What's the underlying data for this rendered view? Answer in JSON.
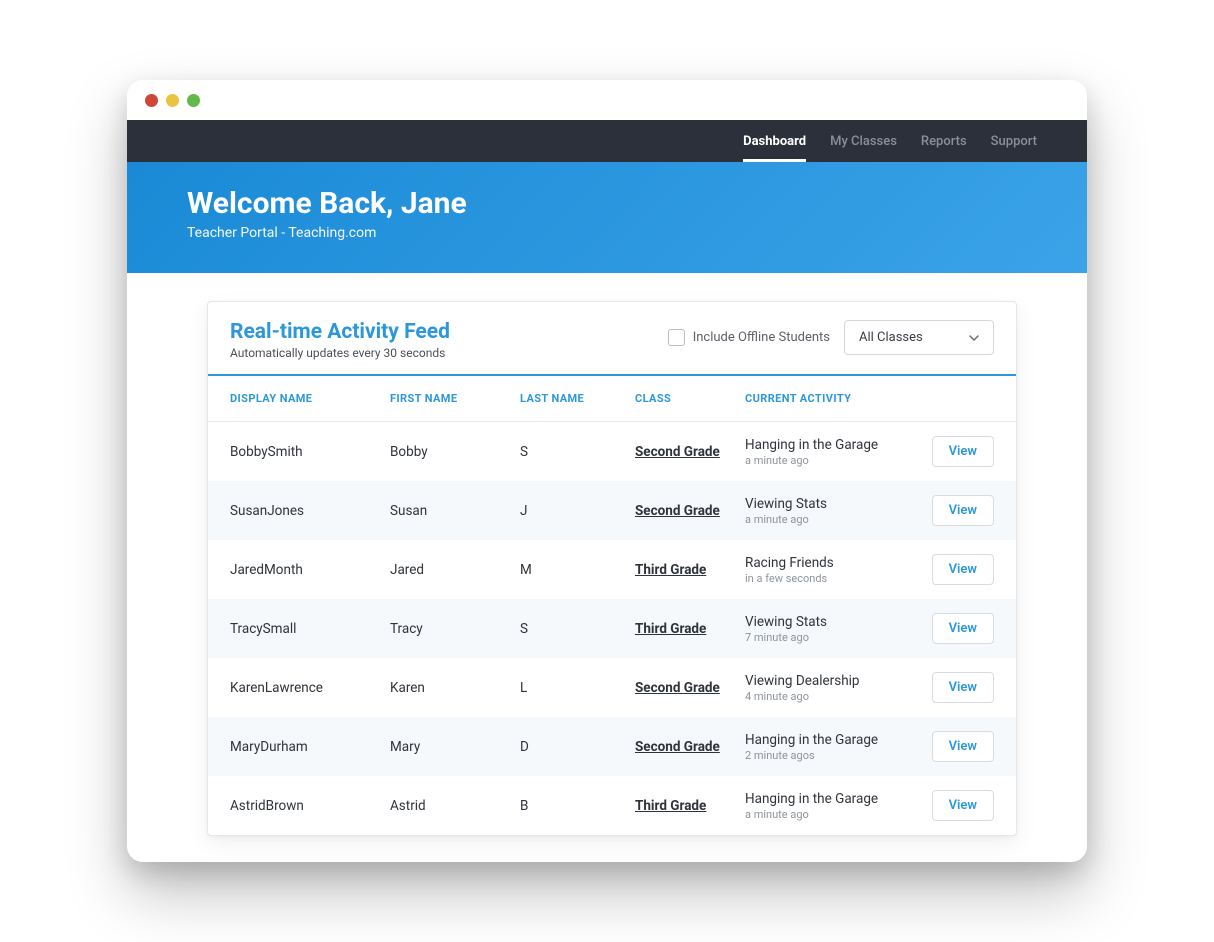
{
  "nav": {
    "items": [
      {
        "label": "Dashboard",
        "active": true
      },
      {
        "label": "My Classes",
        "active": false
      },
      {
        "label": "Reports",
        "active": false
      },
      {
        "label": "Support",
        "active": false
      }
    ]
  },
  "banner": {
    "title": "Welcome Back, Jane",
    "subtitle": "Teacher Portal - Teaching.com"
  },
  "feed": {
    "title": "Real-time Activity Feed",
    "subtitle": "Automatically updates every 30 seconds",
    "includeOfflineLabel": "Include Offline Students",
    "classFilterSelected": "All Classes",
    "columns": {
      "display": "DISPLAY NAME",
      "first": "FIRST NAME",
      "last": "LAST NAME",
      "class": "CLASS",
      "activity": "CURRENT ACTIVITY"
    },
    "viewLabel": "View",
    "rows": [
      {
        "display": "BobbySmith",
        "first": "Bobby",
        "last": "S",
        "class": "Second Grade",
        "activity": "Hanging in the Garage",
        "time": "a minute ago"
      },
      {
        "display": "SusanJones",
        "first": "Susan",
        "last": "J",
        "class": "Second Grade",
        "activity": "Viewing Stats",
        "time": "a minute ago"
      },
      {
        "display": "JaredMonth",
        "first": "Jared",
        "last": "M",
        "class": "Third Grade",
        "activity": "Racing Friends",
        "time": "in a few seconds"
      },
      {
        "display": "TracySmall",
        "first": "Tracy",
        "last": "S",
        "class": "Third Grade",
        "activity": "Viewing Stats",
        "time": "7 minute ago"
      },
      {
        "display": "KarenLawrence",
        "first": "Karen",
        "last": "L",
        "class": "Second Grade",
        "activity": "Viewing Dealership",
        "time": "4 minute ago"
      },
      {
        "display": "MaryDurham",
        "first": "Mary",
        "last": "D",
        "class": "Second Grade",
        "activity": "Hanging in the Garage",
        "time": "2 minute agos"
      },
      {
        "display": "AstridBrown",
        "first": "Astrid",
        "last": "B",
        "class": "Third Grade",
        "activity": "Hanging in the Garage",
        "time": "a minute ago"
      }
    ]
  }
}
